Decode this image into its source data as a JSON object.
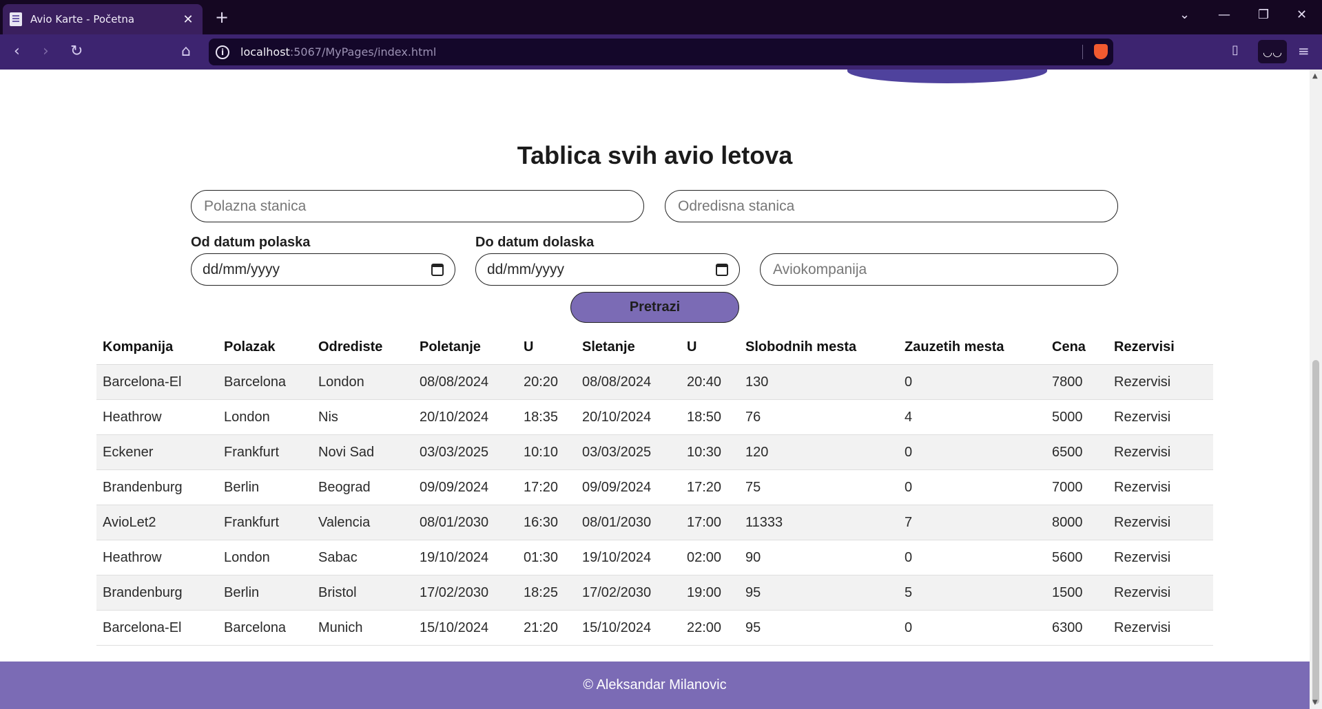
{
  "browser": {
    "tab_title": "Avio Karte - Početna",
    "tab_close": "✕",
    "new_tab": "+",
    "url_host": "localhost",
    "url_path": ":5067/MyPages/index.html",
    "icons": [
      "back-icon",
      "forward-icon",
      "reload-icon",
      "bookmark-icon",
      "site-info-icon",
      "brave-shield-icon",
      "sidebar-icon",
      "reader-icon",
      "menu-icon",
      "tab-list-icon",
      "minimize-icon",
      "restore-icon",
      "close-icon"
    ]
  },
  "page": {
    "title": "Tablica svih avio letova",
    "filters": {
      "departure_placeholder": "Polazna stanica",
      "destination_placeholder": "Odredisna stanica",
      "from_date_label": "Od datum polaska",
      "to_date_label": "Do datum dolaska",
      "from_date_value": "dd/mm/yyyy",
      "to_date_value": "dd/mm/yyyy",
      "airline_placeholder": "Aviokompanija",
      "search_label": "Pretrazi"
    },
    "table": {
      "headers": [
        "Kompanija",
        "Polazak",
        "Odrediste",
        "Poletanje",
        "U",
        "Sletanje",
        "U",
        "Slobodnih mesta",
        "Zauzetih mesta",
        "Cena",
        "Rezervisi"
      ],
      "rows": [
        [
          "Barcelona-El",
          "Barcelona",
          "London",
          "08/08/2024",
          "20:20",
          "08/08/2024",
          "20:40",
          "130",
          "0",
          "7800",
          "Rezervisi"
        ],
        [
          "Heathrow",
          "London",
          "Nis",
          "20/10/2024",
          "18:35",
          "20/10/2024",
          "18:50",
          "76",
          "4",
          "5000",
          "Rezervisi"
        ],
        [
          "Eckener",
          "Frankfurt",
          "Novi Sad",
          "03/03/2025",
          "10:10",
          "03/03/2025",
          "10:30",
          "120",
          "0",
          "6500",
          "Rezervisi"
        ],
        [
          "Brandenburg",
          "Berlin",
          "Beograd",
          "09/09/2024",
          "17:20",
          "09/09/2024",
          "17:20",
          "75",
          "0",
          "7000",
          "Rezervisi"
        ],
        [
          "AvioLet2",
          "Frankfurt",
          "Valencia",
          "08/01/2030",
          "16:30",
          "08/01/2030",
          "17:00",
          "11333",
          "7",
          "8000",
          "Rezervisi"
        ],
        [
          "Heathrow",
          "London",
          "Sabac",
          "19/10/2024",
          "01:30",
          "19/10/2024",
          "02:00",
          "90",
          "0",
          "5600",
          "Rezervisi"
        ],
        [
          "Brandenburg",
          "Berlin",
          "Bristol",
          "17/02/2030",
          "18:25",
          "17/02/2030",
          "19:00",
          "95",
          "5",
          "1500",
          "Rezervisi"
        ],
        [
          "Barcelona-El",
          "Barcelona",
          "Munich",
          "15/10/2024",
          "21:20",
          "15/10/2024",
          "22:00",
          "95",
          "0",
          "6300",
          "Rezervisi"
        ]
      ]
    },
    "footer": "© Aleksandar Milanovic"
  },
  "colors": {
    "accent": "#7b6bb5",
    "link": "#3b6fd6",
    "titlebar": "#150722",
    "toolbar": "#3d2470"
  }
}
